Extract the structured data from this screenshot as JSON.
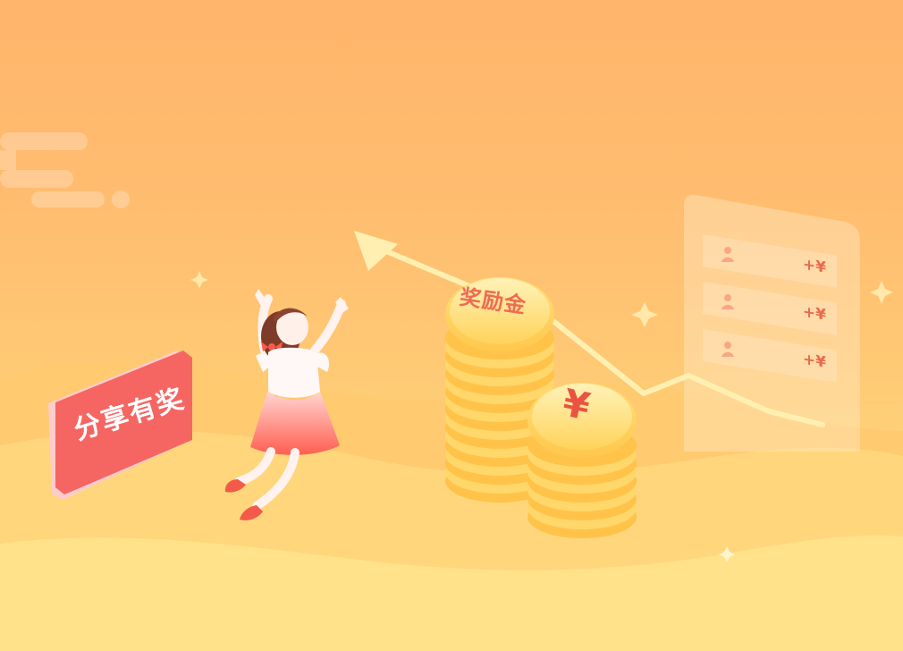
{
  "banner": {
    "sign_text": "分享有奖",
    "coin_label": "奖励金",
    "coin_symbol": "¥",
    "reward_card": {
      "rows": [
        {
          "amount": "+¥"
        },
        {
          "amount": "+¥"
        },
        {
          "amount": "+¥"
        }
      ]
    }
  }
}
